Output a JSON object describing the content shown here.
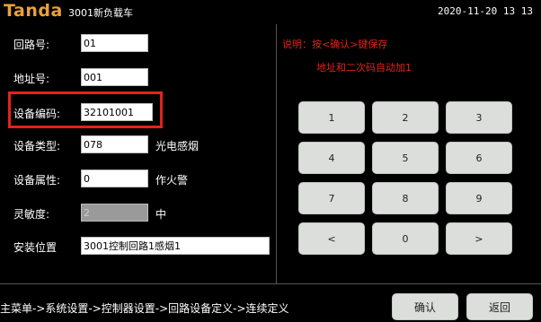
{
  "header": {
    "brand": "Tanda",
    "subtitle": "3001新负载车",
    "datetime": "2020-11-20 13 13"
  },
  "form": {
    "loop_label": "回路号:",
    "loop_value": "01",
    "address_label": "地址号:",
    "address_value": "001",
    "code_label": "设备编码:",
    "code_value": "32101001",
    "type_label": "设备类型:",
    "type_value": "078",
    "type_text": "光电感烟",
    "attr_label": "设备属性:",
    "attr_value": "0",
    "attr_text": "作火警",
    "sens_label": "灵敏度:",
    "sens_value": "2",
    "sens_text": "中",
    "location_label": "安装位置",
    "location_value": "3001控制回路1感烟1"
  },
  "note": {
    "line1": "说明：按<确认>键保存",
    "line2": "地址和二次码自动加1"
  },
  "keypad": {
    "k1": "1",
    "k2": "2",
    "k3": "3",
    "k4": "4",
    "k5": "5",
    "k6": "6",
    "k7": "7",
    "k8": "8",
    "k9": "9",
    "left": "<",
    "k0": "0",
    "right": ">"
  },
  "footer": {
    "breadcrumb": "主菜单->系统设置->控制器设置->回路设备定义->连续定义",
    "confirm": "确认",
    "back": "返回"
  }
}
